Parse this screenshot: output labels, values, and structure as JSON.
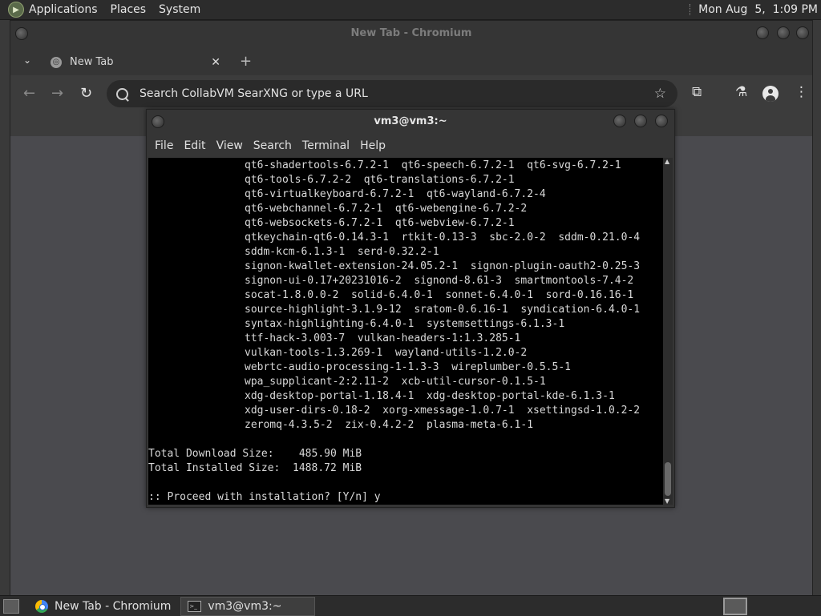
{
  "top_panel": {
    "menus": [
      "Applications",
      "Places",
      "System"
    ],
    "clock": "Mon Aug  5,  1:09 PM"
  },
  "browser": {
    "window_title": "New Tab - Chromium",
    "tab_label": "New Tab",
    "omnibox_placeholder": "Search CollabVM SearXNG or type a URL"
  },
  "terminal": {
    "window_title": "vm3@vm3:~",
    "menus": [
      "File",
      "Edit",
      "View",
      "Search",
      "Terminal",
      "Help"
    ],
    "package_lines": [
      "qt6-shadertools-6.7.2-1  qt6-speech-6.7.2-1  qt6-svg-6.7.2-1",
      "qt6-tools-6.7.2-2  qt6-translations-6.7.2-1",
      "qt6-virtualkeyboard-6.7.2-1  qt6-wayland-6.7.2-4",
      "qt6-webchannel-6.7.2-1  qt6-webengine-6.7.2-2",
      "qt6-websockets-6.7.2-1  qt6-webview-6.7.2-1",
      "qtkeychain-qt6-0.14.3-1  rtkit-0.13-3  sbc-2.0-2  sddm-0.21.0-4",
      "sddm-kcm-6.1.3-1  serd-0.32.2-1",
      "signon-kwallet-extension-24.05.2-1  signon-plugin-oauth2-0.25-3",
      "signon-ui-0.17+20231016-2  signond-8.61-3  smartmontools-7.4-2",
      "socat-1.8.0.0-2  solid-6.4.0-1  sonnet-6.4.0-1  sord-0.16.16-1",
      "source-highlight-3.1.9-12  sratom-0.6.16-1  syndication-6.4.0-1",
      "syntax-highlighting-6.4.0-1  systemsettings-6.1.3-1",
      "ttf-hack-3.003-7  vulkan-headers-1:1.3.285-1",
      "vulkan-tools-1.3.269-1  wayland-utils-1.2.0-2",
      "webrtc-audio-processing-1-1.3-3  wireplumber-0.5.5-1",
      "wpa_supplicant-2:2.11-2  xcb-util-cursor-0.1.5-1",
      "xdg-desktop-portal-1.18.4-1  xdg-desktop-portal-kde-6.1.3-1",
      "xdg-user-dirs-0.18-2  xorg-xmessage-1.0.7-1  xsettingsd-1.0.2-2",
      "zeromq-4.3.5-2  zix-0.4.2-2  plasma-meta-6.1-1"
    ],
    "download_line": "Total Download Size:    485.90 MiB",
    "installed_line": "Total Installed Size:  1488.72 MiB",
    "prompt_line": ":: Proceed with installation? [Y/n] y"
  },
  "taskbar": {
    "tasks": [
      "New Tab - Chromium",
      "vm3@vm3:~"
    ]
  }
}
